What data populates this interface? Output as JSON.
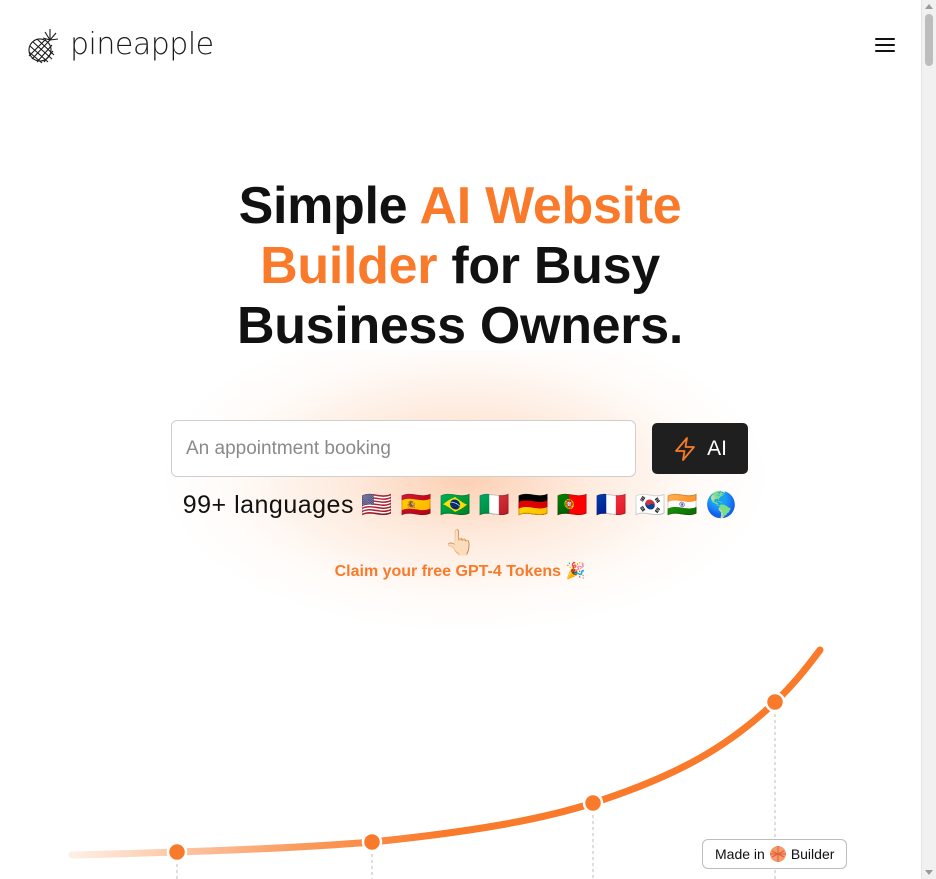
{
  "header": {
    "brand_name": "pineapple",
    "logo_icon": "pineapple-icon",
    "menu_icon": "hamburger-menu-icon"
  },
  "hero": {
    "title_part1": "Simple ",
    "title_accent": "AI Website Builder",
    "title_part2": " for Busy Business Owners.",
    "accent_color": "#f97a2a"
  },
  "prompt": {
    "placeholder": "An appointment booking",
    "value": "",
    "button_label": "AI",
    "button_icon": "lightning-bolt-icon"
  },
  "languages": {
    "label": "99+ languages",
    "flags": "🇺🇸 🇪🇸 🇧🇷 🇮🇹 🇩🇪 🇵🇹 🇫🇷 🇰🇷🇮🇳 🌎",
    "pointer": "👆🏻"
  },
  "claim": {
    "label": "Claim your free GPT-4 Tokens 🎉"
  },
  "growth_curve": {
    "line_color": "#f97a2a",
    "point_count": 4
  },
  "badge": {
    "prefix": "Made in",
    "brand": "Builder",
    "icon": "builder-logo-icon"
  }
}
